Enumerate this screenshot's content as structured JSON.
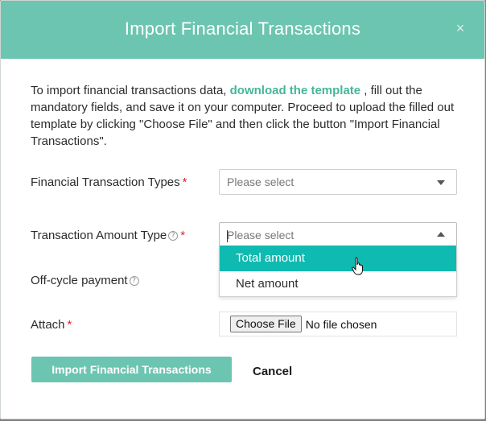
{
  "modal": {
    "title": "Import Financial Transactions",
    "close_symbol": "×"
  },
  "intro": {
    "part1": "To import financial transactions data, ",
    "link": "download the template",
    "part2": " , fill out the mandatory fields, and save it on your computer. Proceed to upload the filled out template by clicking \"Choose File\" and then click the button \"Import Financial Transactions\"."
  },
  "fields": {
    "types": {
      "label": "Financial Transaction Types",
      "required": "*",
      "placeholder": "Please select"
    },
    "amount_type": {
      "label": "Transaction Amount Type",
      "help": "?",
      "required": "*",
      "placeholder": "Please select",
      "options": [
        "Total amount",
        "Net amount"
      ]
    },
    "off_cycle": {
      "label": "Off-cycle payment",
      "help": "?"
    },
    "attach": {
      "label": "Attach",
      "required": "*",
      "button": "Choose File",
      "status": "No file chosen"
    }
  },
  "actions": {
    "import_label": "Import Financial Transactions",
    "cancel_label": "Cancel"
  },
  "colors": {
    "header": "#6cc5b0",
    "link": "#45b59a",
    "option_active": "#0fbab0",
    "required": "#e0232e"
  }
}
